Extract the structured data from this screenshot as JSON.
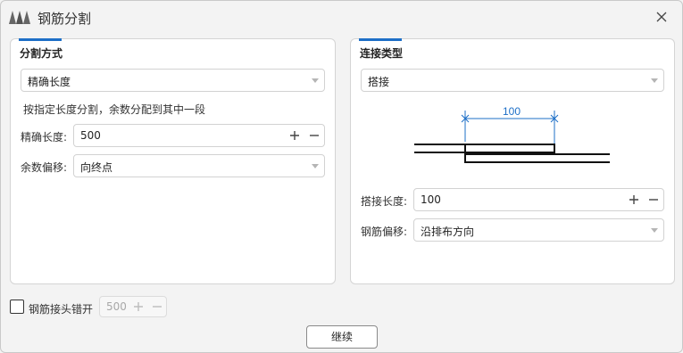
{
  "window": {
    "title": "钢筋分割"
  },
  "split_panel": {
    "title": "分割方式",
    "method_select": {
      "value": "精确长度"
    },
    "hint": "按指定长度分割，余数分配到其中一段",
    "length_label": "精确长度:",
    "length_value": "500",
    "remainder_label": "余数偏移:",
    "remainder_value": "向终点"
  },
  "connect_panel": {
    "title": "连接类型",
    "type_select": {
      "value": "搭接"
    },
    "diagram_dimension": "100",
    "lap_label": "搭接长度:",
    "lap_value": "100",
    "offset_label": "钢筋偏移:",
    "offset_value": "沿排布方向"
  },
  "footer": {
    "stagger_label": "钢筋接头错开",
    "stagger_checked": false,
    "stagger_value": "500",
    "continue_label": "继续"
  },
  "colors": {
    "accent": "#1d6fc7",
    "dimension": "#1d6fc7"
  }
}
